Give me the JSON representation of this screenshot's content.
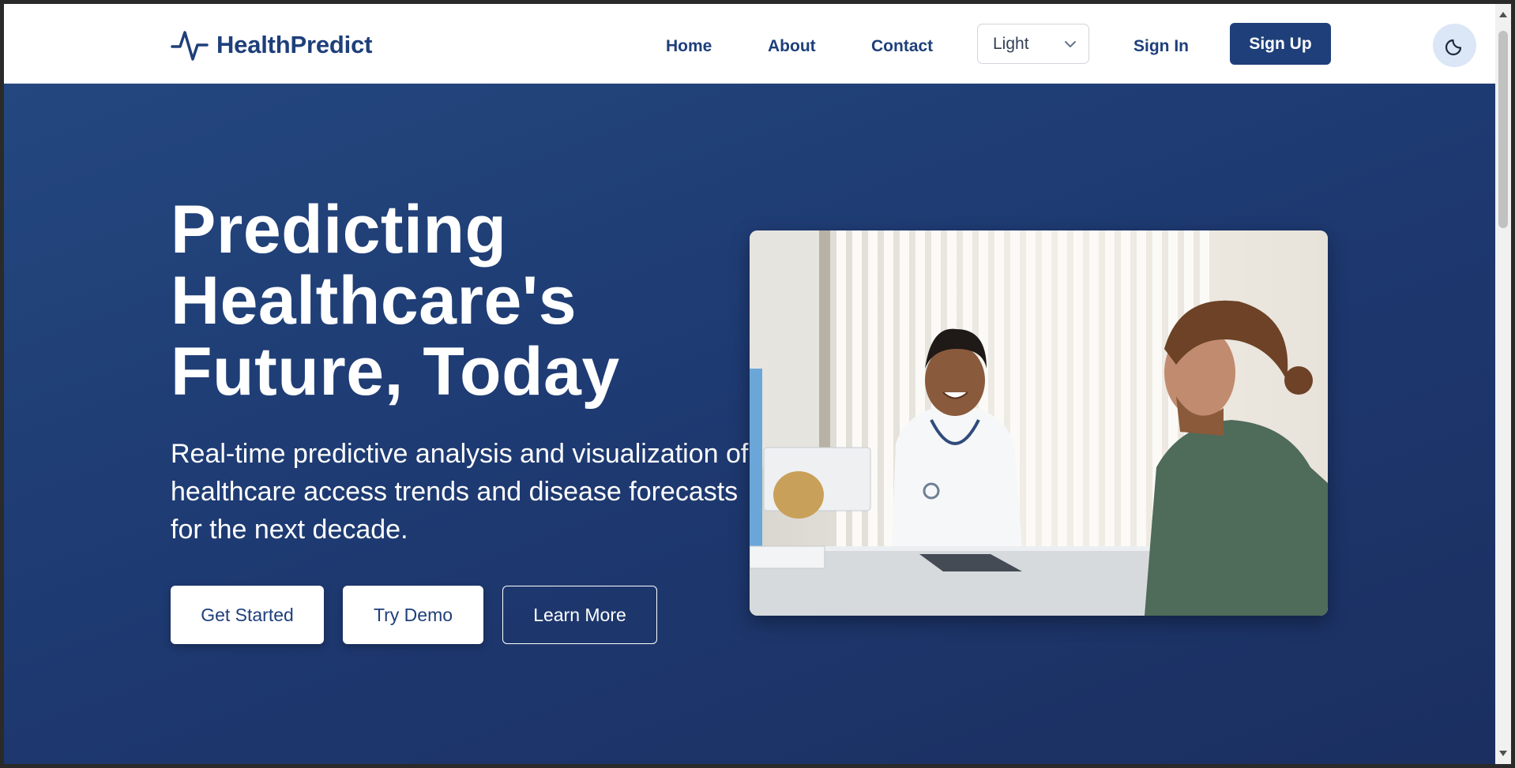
{
  "brand": {
    "name": "HealthPredict",
    "icon": "pulse-icon"
  },
  "nav": {
    "links": [
      {
        "label": "Home"
      },
      {
        "label": "About"
      },
      {
        "label": "Contact"
      }
    ],
    "theme_select": {
      "value": "Light",
      "icon": "chevron-down-icon"
    },
    "sign_in": "Sign In",
    "sign_up": "Sign Up",
    "dark_toggle_icon": "moon-icon"
  },
  "hero": {
    "title_lines": [
      "Predicting",
      "Healthcare's",
      "Future, Today"
    ],
    "subtitle": "Real-time predictive analysis and visualization of healthcare access trends and disease forecasts for the next decade.",
    "buttons": {
      "get_started": "Get Started",
      "try_demo": "Try Demo",
      "learn_more": "Learn More"
    },
    "image": "doctor-consultation-photo"
  },
  "colors": {
    "brand": "#1e3f7a",
    "hero_bg": "#1e3a72",
    "toggle_bg": "#dbe6f6"
  }
}
